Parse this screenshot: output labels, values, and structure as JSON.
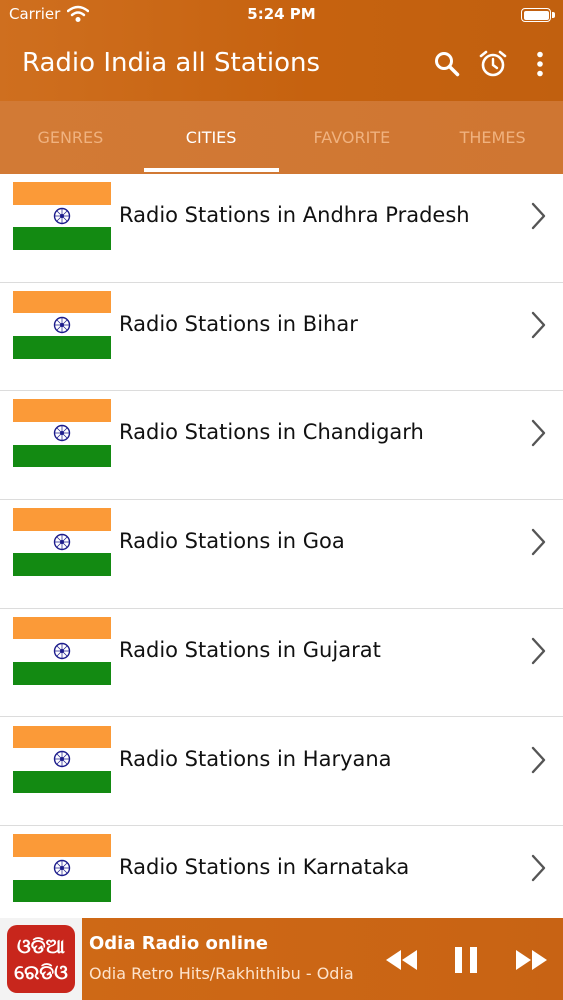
{
  "status_bar": {
    "carrier": "Carrier",
    "time": "5:24 PM"
  },
  "app_bar": {
    "title": "Radio India all Stations",
    "icons": [
      "search-icon",
      "alarm-clock-icon",
      "more-vert-icon"
    ]
  },
  "tabs": [
    {
      "label": "GENRES",
      "active": false
    },
    {
      "label": "CITIES",
      "active": true
    },
    {
      "label": "FAVORITE",
      "active": false
    },
    {
      "label": "THEMES",
      "active": false
    }
  ],
  "list": {
    "items": [
      {
        "label": "Radio Stations in Andhra Pradesh",
        "icon": "india-flag-icon"
      },
      {
        "label": "Radio Stations in Bihar",
        "icon": "india-flag-icon"
      },
      {
        "label": "Radio Stations in Chandigarh",
        "icon": "india-flag-icon"
      },
      {
        "label": "Radio Stations in Goa",
        "icon": "india-flag-icon"
      },
      {
        "label": "Radio Stations in Gujarat",
        "icon": "india-flag-icon"
      },
      {
        "label": "Radio Stations in Haryana",
        "icon": "india-flag-icon"
      },
      {
        "label": "Radio Stations in Karnataka",
        "icon": "india-flag-icon"
      }
    ]
  },
  "player": {
    "logo_line1": "ଓଡିଆ",
    "logo_line2": "ରେଡିଓ",
    "title": "Odia Radio online",
    "subtitle": "Odia Retro Hits/Rakhithibu - Odia",
    "controls": [
      "rewind-icon",
      "pause-icon",
      "fast-forward-icon"
    ]
  },
  "colors": {
    "header": "#c6620f",
    "tab_bar": "#d27a35",
    "flag_saffron": "#fb9a38",
    "flag_green": "#138a12",
    "chakra_blue": "#1c1c8c",
    "player": "#cf6a16",
    "logo_red": "#c8261c"
  }
}
